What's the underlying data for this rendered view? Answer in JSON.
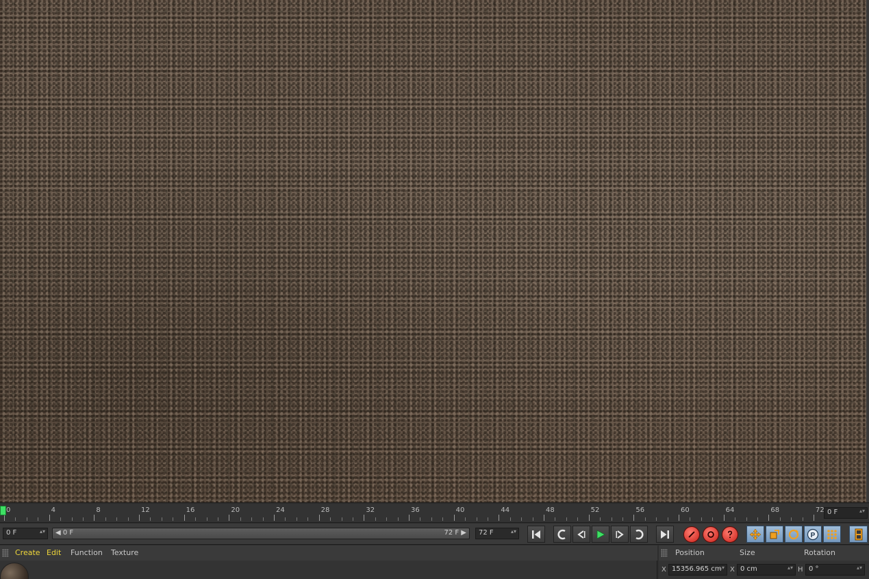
{
  "timeline": {
    "ticks": [
      "0",
      "4",
      "8",
      "12",
      "16",
      "20",
      "24",
      "28",
      "32",
      "36",
      "40",
      "44",
      "48",
      "52",
      "56",
      "60",
      "64",
      "68",
      "72"
    ],
    "current_frame": "0 F"
  },
  "transport": {
    "start_field": "0 F",
    "range_start": "◀ 0 F",
    "range_end": "72 F ▶",
    "end_field": "72 F",
    "spin_glyph": "▴▾"
  },
  "material_menu": {
    "items": [
      "Create",
      "Edit",
      "Function",
      "Texture"
    ]
  },
  "coordinates": {
    "headers": [
      "Position",
      "Size",
      "Rotation"
    ],
    "row": {
      "pos_axis": "X",
      "pos_value": "15356.965 cm",
      "size_axis": "X",
      "size_value": "0 cm",
      "rot_axis": "H",
      "rot_value": "0 °"
    }
  },
  "colors": {
    "playhead": "#3ee064",
    "record": "#c9221b",
    "tool_active": "#7598bd",
    "menu_highlight": "#f1d83a"
  },
  "icons": {
    "goto-start": "goto-start-icon",
    "prev-key": "prev-keyframe-icon",
    "prev-frame": "prev-frame-icon",
    "play": "play-icon",
    "next-frame": "next-frame-icon",
    "next-key": "next-keyframe-icon",
    "goto-end": "goto-end-icon",
    "record": "record-icon",
    "autokey": "autokey-icon",
    "keyframe-selection": "keyframe-selection-icon",
    "move": "move-icon",
    "scale": "scale-icon",
    "rotate": "rotate-icon",
    "parameter": "parameter-icon",
    "pla": "pla-grid-icon",
    "film": "film-icon"
  }
}
